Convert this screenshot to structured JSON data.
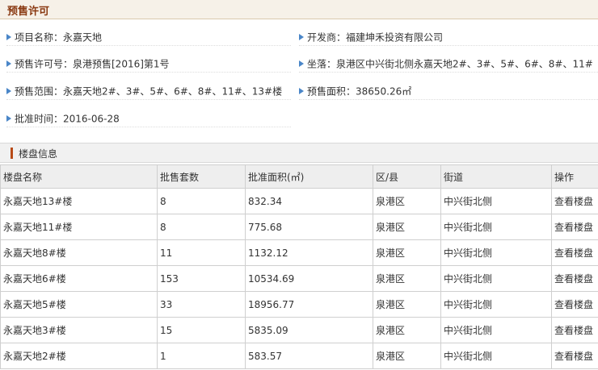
{
  "header": {
    "title": "预售许可"
  },
  "info": {
    "project_name": "项目名称：永嘉天地",
    "developer": "开发商：福建坤禾投资有限公司",
    "permit_no": "预售许可号：泉港预售[2016]第1号",
    "location": "坐落：泉港区中兴街北侧永嘉天地2#、3#、5#、6#、8#、11#",
    "scope": "预售范围：永嘉天地2#、3#、5#、6#、8#、11#、13#楼",
    "area": "预售面积：38650.26㎡",
    "approve_date": "批准时间：2016-06-28"
  },
  "section": {
    "title": "楼盘信息"
  },
  "table": {
    "headers": [
      "楼盘名称",
      "批售套数",
      "批准面积(㎡)",
      "区/县",
      "街道",
      "操作"
    ],
    "rows": [
      {
        "name": "永嘉天地13#楼",
        "units": "8",
        "area": "832.34",
        "district": "泉港区",
        "street": "中兴街北侧",
        "action": "查看楼盘"
      },
      {
        "name": "永嘉天地11#楼",
        "units": "8",
        "area": "775.68",
        "district": "泉港区",
        "street": "中兴街北侧",
        "action": "查看楼盘"
      },
      {
        "name": "永嘉天地8#楼",
        "units": "11",
        "area": "1132.12",
        "district": "泉港区",
        "street": "中兴街北侧",
        "action": "查看楼盘"
      },
      {
        "name": "永嘉天地6#楼",
        "units": "153",
        "area": "10534.69",
        "district": "泉港区",
        "street": "中兴街北侧",
        "action": "查看楼盘"
      },
      {
        "name": "永嘉天地5#楼",
        "units": "33",
        "area": "18956.77",
        "district": "泉港区",
        "street": "中兴街北侧",
        "action": "查看楼盘"
      },
      {
        "name": "永嘉天地3#楼",
        "units": "15",
        "area": "5835.09",
        "district": "泉港区",
        "street": "中兴街北侧",
        "action": "查看楼盘"
      },
      {
        "name": "永嘉天地2#楼",
        "units": "1",
        "area": "583.57",
        "district": "泉港区",
        "street": "中兴街北侧",
        "action": "查看楼盘"
      }
    ]
  },
  "icons": {
    "bullet": "triangle-right-icon"
  },
  "colors": {
    "title": "#8a3a12",
    "bullet": "#4a86c8",
    "accent_bar": "#b84a17"
  }
}
